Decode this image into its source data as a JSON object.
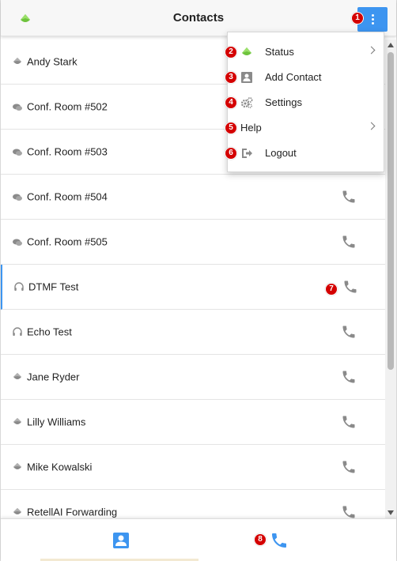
{
  "header": {
    "title": "Contacts",
    "menu_button": "more-vert"
  },
  "contacts": [
    {
      "name": "Andy Stark",
      "icon": "status-gray-icon",
      "call": false
    },
    {
      "name": "Conf. Room #502",
      "icon": "chat-bubbles-icon",
      "call": false
    },
    {
      "name": "Conf. Room #503",
      "icon": "chat-bubbles-icon",
      "call": false
    },
    {
      "name": "Conf. Room #504",
      "icon": "chat-bubbles-icon",
      "call": true
    },
    {
      "name": "Conf. Room #505",
      "icon": "chat-bubbles-icon",
      "call": true
    },
    {
      "name": "DTMF Test",
      "icon": "headset-icon",
      "call": true
    },
    {
      "name": "Echo Test",
      "icon": "headset-icon",
      "call": true
    },
    {
      "name": "Jane Ryder",
      "icon": "status-gray-icon",
      "call": true
    },
    {
      "name": "Lilly Williams",
      "icon": "status-gray-icon",
      "call": true
    },
    {
      "name": "Mike Kowalski",
      "icon": "status-gray-icon",
      "call": true
    },
    {
      "name": "RetellAI Forwarding",
      "icon": "status-gray-icon",
      "call": true
    }
  ],
  "menu": {
    "items": [
      {
        "label": "Status",
        "icon": "status-green-icon",
        "submenu": true
      },
      {
        "label": "Add Contact",
        "icon": "add-contact-icon",
        "submenu": false
      },
      {
        "label": "Settings",
        "icon": "gears-icon",
        "submenu": false
      },
      {
        "label": "Help",
        "icon": "",
        "submenu": true
      },
      {
        "label": "Logout",
        "icon": "logout-icon",
        "submenu": false
      }
    ]
  },
  "badges": [
    "1",
    "2",
    "3",
    "4",
    "5",
    "6",
    "7",
    "8"
  ],
  "footer": {
    "tabs": [
      "contacts-tab",
      "calls-tab"
    ]
  },
  "colors": {
    "accent": "#3d95f0",
    "badge": "#d40000",
    "status_green": "#6ec33d",
    "icon_gray": "#8a8a8a"
  }
}
